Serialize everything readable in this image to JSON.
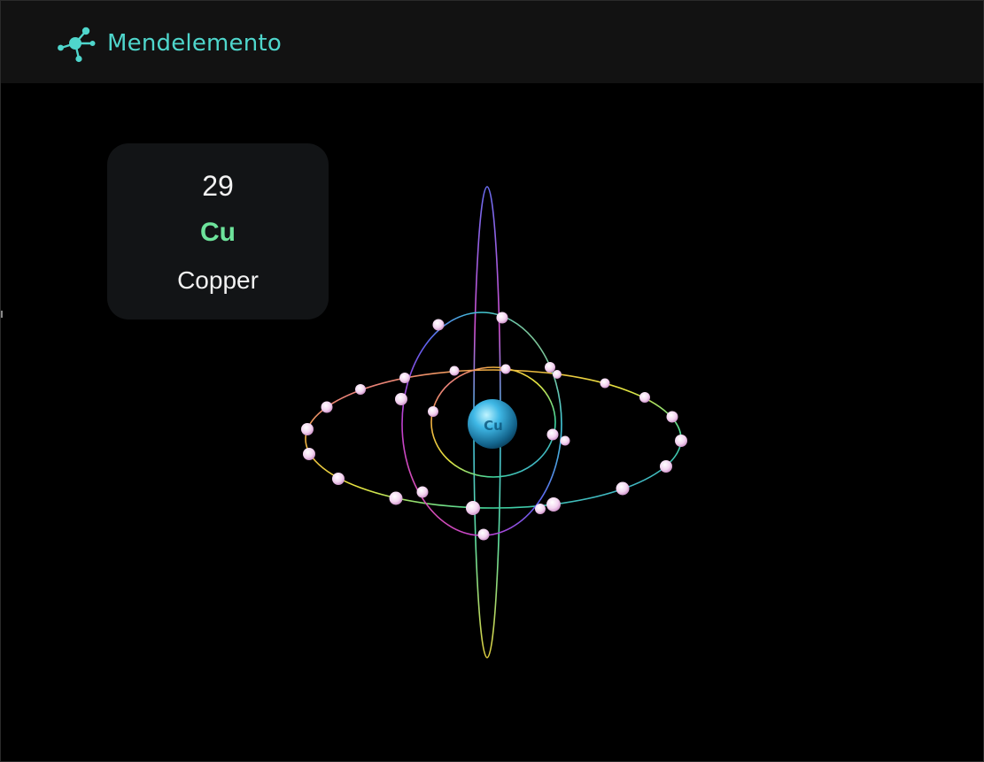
{
  "app": {
    "brand_name": "Mendelemento",
    "brand_color": "#4fd6cc",
    "logo_icon": "molecule-icon"
  },
  "element": {
    "atomic_number": "29",
    "symbol": "Cu",
    "name": "Copper",
    "symbol_color": "#6de39b"
  },
  "atom_model": {
    "nucleus_label": "Cu",
    "nucleus_color": "#2aa8d8",
    "electron_color": "#f3d4f0",
    "electron_shells": [
      2,
      8,
      18,
      1
    ]
  }
}
